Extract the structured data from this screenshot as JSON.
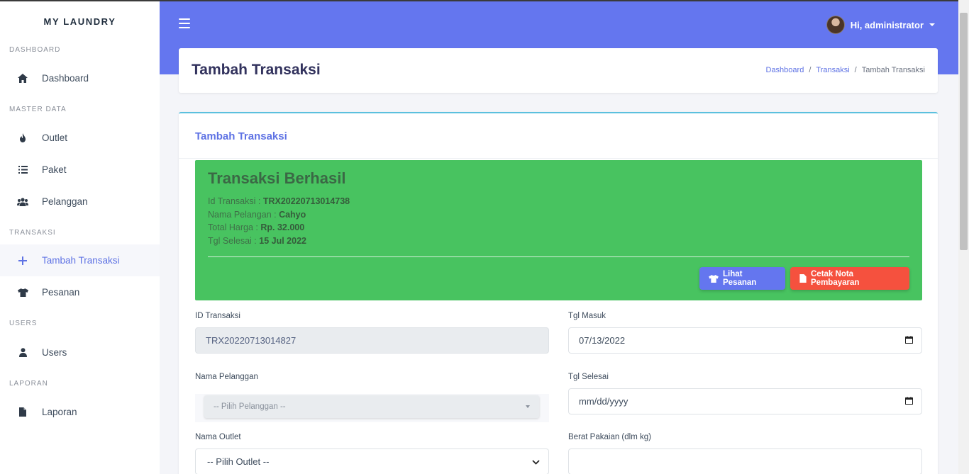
{
  "brand": "MY LAUNDRY",
  "sidebar": {
    "sections": [
      {
        "title": "DASHBOARD",
        "items": [
          {
            "label": "Dashboard",
            "icon": "home-icon"
          }
        ]
      },
      {
        "title": "MASTER DATA",
        "items": [
          {
            "label": "Outlet",
            "icon": "fire-icon"
          },
          {
            "label": "Paket",
            "icon": "list-icon"
          },
          {
            "label": "Pelanggan",
            "icon": "users-icon"
          }
        ]
      },
      {
        "title": "TRANSAKSI",
        "items": [
          {
            "label": "Tambah Transaksi",
            "icon": "plus-icon",
            "active": true
          },
          {
            "label": "Pesanan",
            "icon": "tshirt-icon"
          }
        ]
      },
      {
        "title": "USERS",
        "items": [
          {
            "label": "Users",
            "icon": "user-icon"
          }
        ]
      },
      {
        "title": "LAPORAN",
        "items": [
          {
            "label": "Laporan",
            "icon": "file-icon"
          }
        ]
      }
    ]
  },
  "header": {
    "user_greeting": "Hi, administrator",
    "page_title": "Tambah Transaksi",
    "breadcrumb": [
      "Dashboard",
      "Transaksi",
      "Tambah Transaksi"
    ]
  },
  "card": {
    "title": "Tambah Transaksi",
    "alert": {
      "heading": "Transaksi Berhasil",
      "rows": [
        {
          "label": "Id Transaksi : ",
          "value": "TRX20220713014738"
        },
        {
          "label": "Nama Pelangan : ",
          "value": "Cahyo"
        },
        {
          "label": "Total Harga : ",
          "value": "Rp. 32.000"
        },
        {
          "label": "Tgl Selesai : ",
          "value": "15 Jul 2022"
        }
      ],
      "btn_view": "Lihat Pesanan",
      "btn_print": "Cetak Nota Pembayaran"
    },
    "form": {
      "id_label": "ID Transaksi",
      "id_value": "TRX20220713014827",
      "tgl_masuk_label": "Tgl Masuk",
      "tgl_masuk_value": "07/13/2022",
      "pelanggan_label": "Nama Pelanggan",
      "pelanggan_placeholder": "-- Pilih Pelanggan --",
      "tgl_selesai_label": "Tgl Selesai",
      "tgl_selesai_value": "mm/dd/yyyy",
      "outlet_label": "Nama Outlet",
      "outlet_value": "-- Pilih Outlet --",
      "berat_label": "Berat Pakaian (dlm kg)",
      "berat_value": ""
    }
  },
  "colors": {
    "primary": "#6476ef",
    "success": "#48c360",
    "danger": "#f5513e",
    "info_border": "#5bc0de"
  }
}
